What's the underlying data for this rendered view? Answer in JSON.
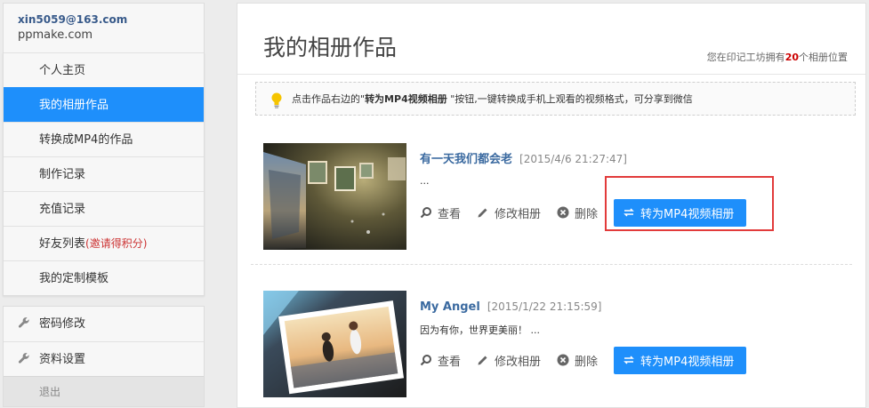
{
  "user": {
    "email": "xin5059@163.com",
    "site": "ppmake.com"
  },
  "menu": [
    {
      "label": "个人主页"
    },
    {
      "label": "我的相册作品"
    },
    {
      "label": "转换成MP4的作品"
    },
    {
      "label": "制作记录"
    },
    {
      "label": "充值记录"
    },
    {
      "label": "好友列表",
      "hint": "(邀请得积分)"
    },
    {
      "label": "我的定制模板"
    }
  ],
  "settings": [
    {
      "label": "密码修改",
      "icon": "wrench-icon"
    },
    {
      "label": "资料设置",
      "icon": "wrench-icon"
    }
  ],
  "logout": "退出",
  "page": {
    "title": "我的相册作品",
    "quota_prefix": "您在印记工坊拥有",
    "quota_count": "20",
    "quota_suffix": "个相册位置"
  },
  "tip": {
    "prefix": "点击作品右边的\"",
    "bold": "转为MP4视频相册",
    "suffix": " \"按钮,一键转换成手机上观看的视频格式，可分享到微信"
  },
  "albums": [
    {
      "title": "有一天我们都会老",
      "date": "[2015/4/6 21:27:47]",
      "desc": "..."
    },
    {
      "title": "My Angel",
      "date": "[2015/1/22 21:15:59]",
      "desc": "因为有你，世界更美丽！ ..."
    }
  ],
  "actions": {
    "view": "查看",
    "edit": "修改相册",
    "delete": "删除",
    "convert": "转为MP4视频相册"
  },
  "colors": {
    "accent": "#1e8ffb",
    "highlight": "#e23b3b",
    "link": "#3b6aa0"
  }
}
